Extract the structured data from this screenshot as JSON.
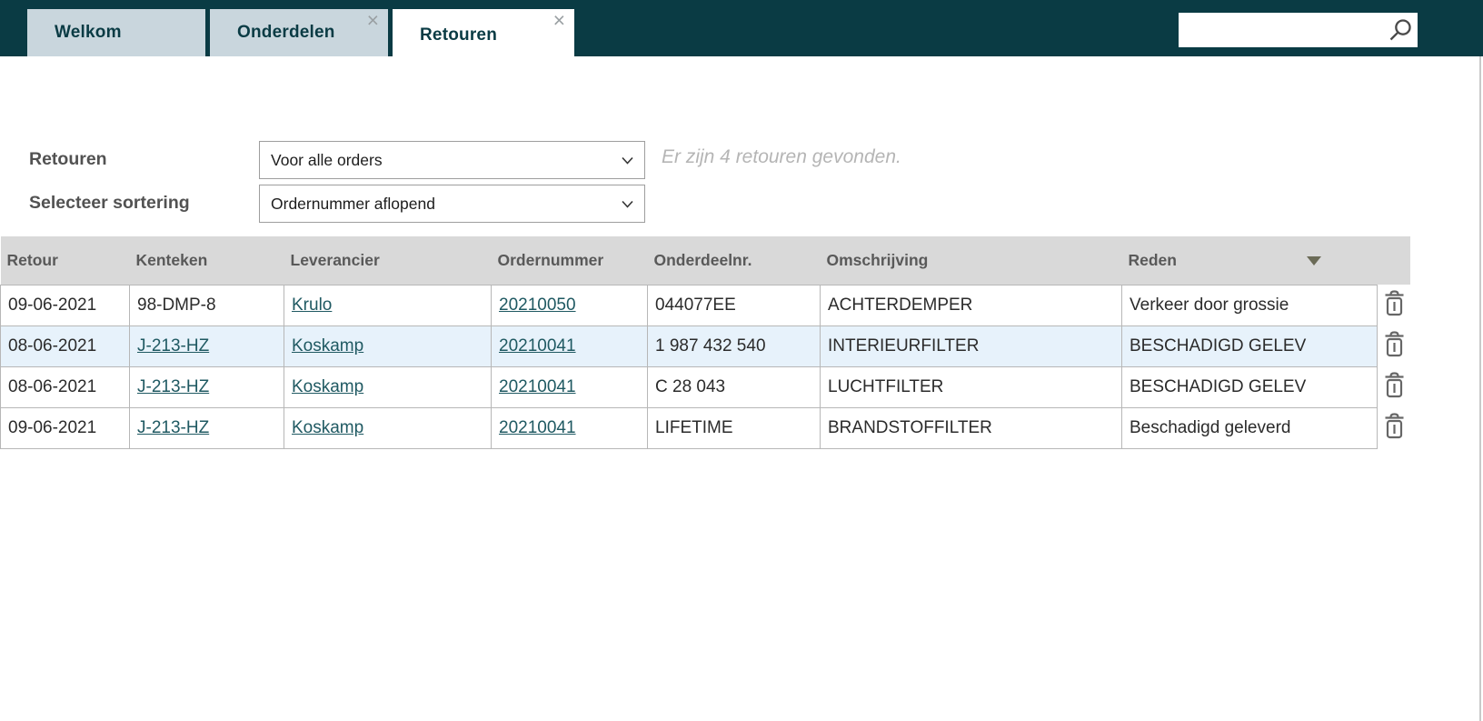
{
  "colors": {
    "topbar_bg": "#0a3b44",
    "inactive_tab_bg": "#c9d6dd",
    "active_tab_bg": "#ffffff",
    "tab_text": "#0a3b44",
    "table_header_bg": "#d9d9d9",
    "row_highlight_bg": "#e7f2fb",
    "link_color": "#1f5962",
    "table_border": "#b7b7b7",
    "result_msg_color": "#b5b5b5"
  },
  "icons": {
    "close": "×",
    "search": "magnifier",
    "delete": "trash-can",
    "sort": "triangle-down",
    "select_chevron": "chevron-down"
  },
  "tabs": [
    {
      "label": "Welkom",
      "active": false,
      "closable": false
    },
    {
      "label": "Onderdelen",
      "active": false,
      "closable": true
    },
    {
      "label": "Retouren",
      "active": true,
      "closable": true
    }
  ],
  "search": {
    "value": "",
    "placeholder": ""
  },
  "filters": {
    "retouren_label": "Retouren",
    "orders_filter_value": "Voor alle orders",
    "sort_label": "Selecteer sortering",
    "sort_value": "Ordernummer aflopend",
    "result_message": "Er zijn 4 retouren gevonden."
  },
  "table": {
    "columns": [
      "Retour",
      "Kenteken",
      "Leverancier",
      "Ordernummer",
      "Onderdeelnr.",
      "Omschrijving",
      "Reden"
    ],
    "rows": [
      {
        "retour": "09-06-2021",
        "kenteken": "98-DMP-8",
        "kenteken_is_link": false,
        "leverancier": "Krulo",
        "ordernummer": "20210050",
        "onderdeelnr": "044077EE",
        "omschrijving": "ACHTERDEMPER",
        "reden": "Verkeer door grossie",
        "highlighted": false
      },
      {
        "retour": "08-06-2021",
        "kenteken": "J-213-HZ",
        "kenteken_is_link": true,
        "leverancier": "Koskamp",
        "ordernummer": "20210041",
        "onderdeelnr": "1 987 432 540",
        "omschrijving": "INTERIEURFILTER",
        "reden": "BESCHADIGD GELEV",
        "highlighted": true
      },
      {
        "retour": "08-06-2021",
        "kenteken": "J-213-HZ",
        "kenteken_is_link": true,
        "leverancier": "Koskamp",
        "ordernummer": "20210041",
        "onderdeelnr": "C 28 043",
        "omschrijving": "LUCHTFILTER",
        "reden": "BESCHADIGD GELEV",
        "highlighted": false
      },
      {
        "retour": "09-06-2021",
        "kenteken": "J-213-HZ",
        "kenteken_is_link": true,
        "leverancier": "Koskamp",
        "ordernummer": "20210041",
        "onderdeelnr": "LIFETIME",
        "omschrijving": "BRANDSTOFFILTER",
        "reden": "Beschadigd geleverd",
        "highlighted": false
      }
    ]
  }
}
